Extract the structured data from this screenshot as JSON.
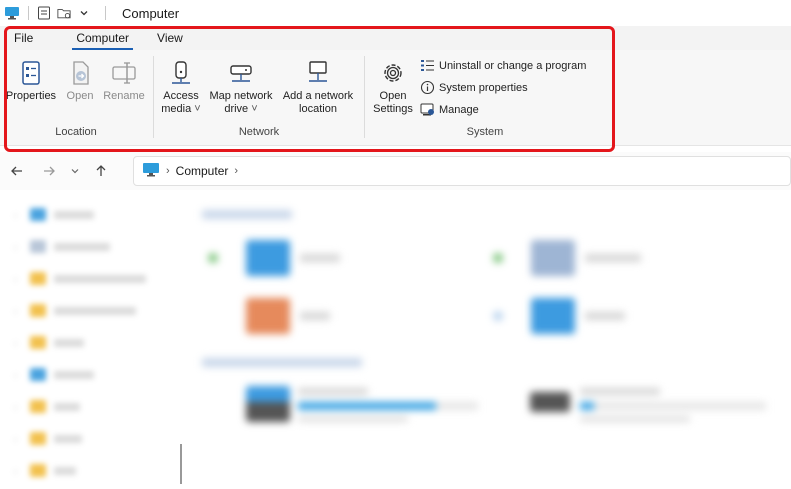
{
  "window": {
    "title": "Computer"
  },
  "ribbon": {
    "tabs": [
      "File",
      "Computer",
      "View"
    ],
    "location": {
      "label": "Location",
      "buttons": [
        {
          "label": "Properties",
          "icon": "properties-icon",
          "enabled": true
        },
        {
          "label": "Open",
          "icon": "open-icon",
          "enabled": false
        },
        {
          "label": "Rename",
          "icon": "rename-icon",
          "enabled": false
        }
      ]
    },
    "network": {
      "label": "Network",
      "buttons": [
        {
          "label_line1": "Access",
          "label_line2": "media",
          "icon": "access-media-icon",
          "dropdown": true
        },
        {
          "label_line1": "Map network",
          "label_line2": "drive",
          "icon": "map-network-drive-icon",
          "dropdown": true
        },
        {
          "label_line1": "Add a network",
          "label_line2": "location",
          "icon": "add-network-location-icon",
          "dropdown": false
        }
      ]
    },
    "system": {
      "label": "System",
      "open_settings_line1": "Open",
      "open_settings_line2": "Settings",
      "items": [
        {
          "label": "Uninstall or change a program",
          "icon": "uninstall-program-icon"
        },
        {
          "label": "System properties",
          "icon": "info-icon"
        },
        {
          "label": "Manage",
          "icon": "manage-icon"
        }
      ]
    }
  },
  "address": {
    "crumb": "Computer"
  },
  "colors": {
    "accent": "#1a5fb4",
    "highlight": "#e4161b",
    "folder": "#f2c14e",
    "drive_fill": "#3aa3e3"
  }
}
